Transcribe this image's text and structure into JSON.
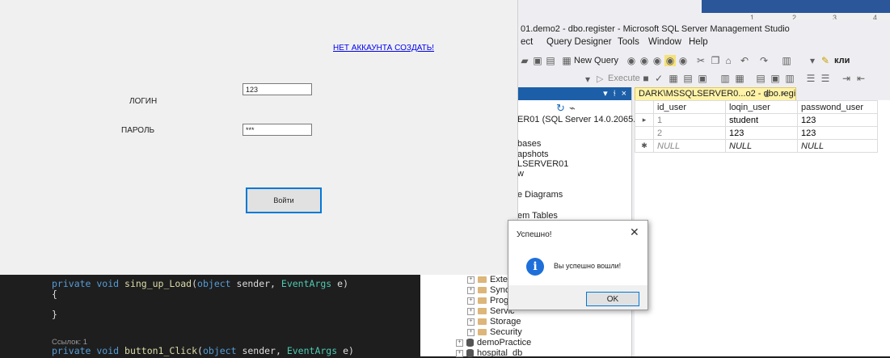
{
  "word": {
    "ruler_marks": [
      "1",
      "2",
      "3",
      "4"
    ]
  },
  "ssms": {
    "title": "01.demo2 - dbo.register - Microsoft SQL Server Management Studio",
    "menu": [
      "ect",
      "Query Designer",
      "Tools",
      "Window",
      "Help"
    ],
    "toolbar": {
      "new_query": "New Query",
      "execute": "Execute",
      "right_text": "кли"
    },
    "object_explorer": {
      "header_controls": "▾ ⫮ ×",
      "server": "ER01 (SQL Server 14.0.2065.1 - I",
      "items": [
        "bases",
        "apshots",
        "LSERVER01",
        "w",
        "e Diagrams",
        "em Tables"
      ],
      "folders": [
        "Exter",
        "Synor",
        "Progr",
        "Servic",
        "Storage",
        "Security"
      ],
      "databases": [
        "demoPractice",
        "hospital_db"
      ]
    },
    "query_tab": {
      "title": "DARK\\MSSQLSERVER0...o2 - dbo.register",
      "pin": "⊕",
      "close": "×"
    },
    "grid": {
      "columns": [
        "id_user",
        "loqin_user",
        "passwond_user"
      ],
      "rows": [
        {
          "marker": "▸",
          "cells": [
            "1",
            "student",
            "123"
          ]
        },
        {
          "marker": "",
          "cells": [
            "2",
            "123",
            "123"
          ]
        },
        {
          "marker": "✱",
          "cells": [
            "NULL",
            "NULL",
            "NULL"
          ]
        }
      ]
    }
  },
  "code": {
    "line1_kw": "private void ",
    "line1_fn": "sing_up_Load",
    "line1_open": "(",
    "line1_kw2": "object",
    "line1_mid": " sender, ",
    "line1_type": "EventArgs",
    "line1_end": " e)",
    "brace_open": "{",
    "brace_close": "}",
    "refs": "Ссылок: 1",
    "line2_kw": "private void ",
    "line2_fn": "button1_Click",
    "line2_open": "(",
    "line2_kw2": "object",
    "line2_mid": " sender, ",
    "line2_type": "EventArgs",
    "line2_end": " e)"
  },
  "login": {
    "register_link": "НЕТ АККАУНТА СОЗДАТЬ!",
    "login_label": "ЛОГИН",
    "login_value": "123",
    "password_label": "ПАРОЛЬ",
    "password_value": "***",
    "submit_label": "Войти"
  },
  "dialog": {
    "title": "Успешно!",
    "close": "✕",
    "icon": "i",
    "message": "Вы успешно вошли!",
    "ok": "OK"
  }
}
